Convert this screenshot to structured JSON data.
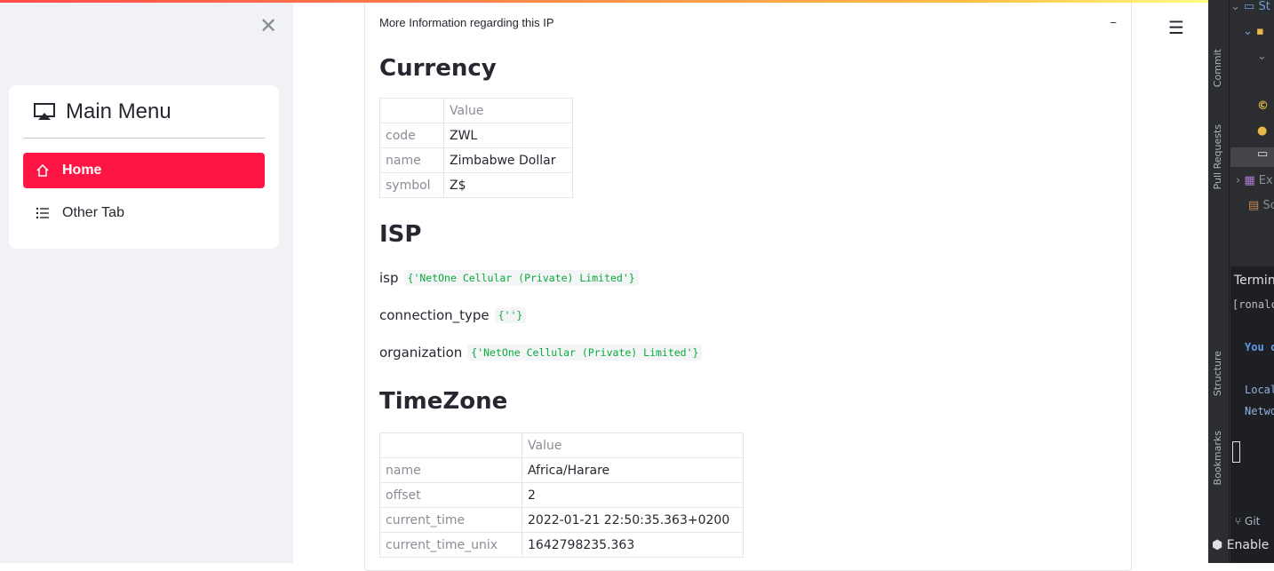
{
  "sidebar": {
    "menu_title": "Main Menu",
    "items": [
      {
        "label": "Home",
        "active": true
      },
      {
        "label": "Other Tab",
        "active": false
      }
    ],
    "accent_color": "#ff1543"
  },
  "main": {
    "expander_title": "More Information regarding this IP",
    "collapse_symbol": "−",
    "currency": {
      "heading": "Currency",
      "column_header": "Value",
      "rows": [
        {
          "key": "code",
          "value": "ZWL"
        },
        {
          "key": "name",
          "value": "Zimbabwe Dollar"
        },
        {
          "key": "symbol",
          "value": "Z$"
        }
      ]
    },
    "isp": {
      "heading": "ISP",
      "fields": [
        {
          "key": "isp",
          "value": "{'NetOne Cellular (Private) Limited'}"
        },
        {
          "key": "connection_type",
          "value": "{''}"
        },
        {
          "key": "organization",
          "value": "{'NetOne Cellular (Private) Limited'}"
        }
      ]
    },
    "timezone": {
      "heading": "TimeZone",
      "column_header": "Value",
      "rows": [
        {
          "key": "name",
          "value": "Africa/Harare"
        },
        {
          "key": "offset",
          "value": "2"
        },
        {
          "key": "current_time",
          "value": "2022-01-21 22:50:35.363+0200"
        },
        {
          "key": "current_time_unix",
          "value": "1642798235.363"
        }
      ]
    }
  },
  "ide": {
    "side_labels": [
      "Commit",
      "Pull Requests",
      "Structure",
      "Bookmarks"
    ],
    "tree_rows": [
      "St",
      "",
      "",
      "",
      "",
      "",
      "Ex",
      "Sc"
    ],
    "terminal_title": "Termin",
    "terminal_lines": [
      "[ronalc",
      "You c",
      "Local",
      "Netwo"
    ],
    "git_label": "Git",
    "enable_label": "Enable"
  }
}
